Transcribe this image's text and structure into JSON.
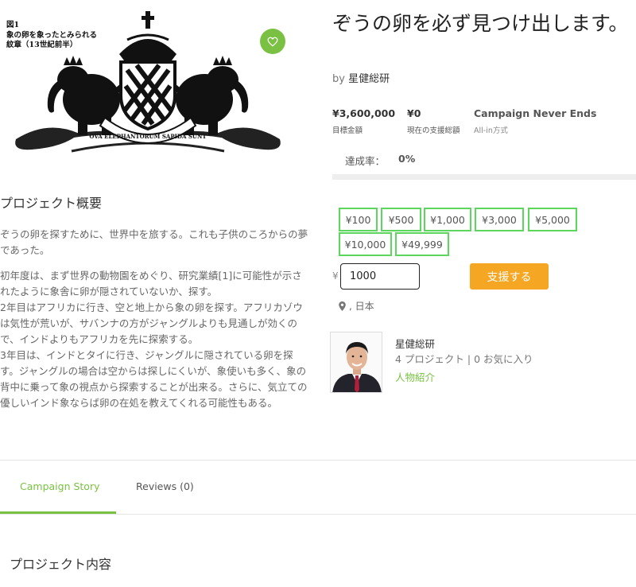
{
  "hero": {
    "caption_lines": [
      "図1",
      "象の卵を象ったとみられる",
      "紋章（13世紀前半）"
    ],
    "banner_text": "OVA ELEPHANTORUM SAPIDA SUNT",
    "favorite_icon": "heart-icon"
  },
  "project": {
    "title": "ぞうの卵を必ず見つけ出します。",
    "by_label": "by",
    "author": "星健総研"
  },
  "stats": {
    "goal_value": "¥3,600,000",
    "goal_label": "目標金額",
    "current_value": "¥0",
    "current_label": "現在の支援総額",
    "ends_value": "Campaign Never Ends",
    "ends_label": "All-in方式",
    "rate_label": "達成率：",
    "rate_value": "0%",
    "progress_fraction": 0
  },
  "amounts": [
    "¥100",
    "¥500",
    "¥1,000",
    "¥3,000",
    "¥5,000",
    "¥10,000",
    "¥49,999"
  ],
  "pledge": {
    "currency": "¥",
    "input_value": "1000",
    "button_label": "支援する"
  },
  "location": {
    "icon": "map-pin-icon",
    "text": ", 日本"
  },
  "creator": {
    "name": "星健総研",
    "stats": "4 プロジェクト | 0 お気に入り",
    "link_label": "人物紹介"
  },
  "summary": {
    "title": "プロジェクト概要",
    "paragraph1": "ぞうの卵を探すために、世界中を旅する。これも子供のころからの夢であった。",
    "line1": "初年度は、まず世界の動物園をめぐり、研究業績[1]に可能性が示されたように象舎に卵が隠されていないか、探す。",
    "line2": "2年目はアフリカに行き、空と地上から象の卵を探す。アフリカゾウは気性が荒いが、サバンナの方がジャングルよりも見通しが効くので、インドよりもアフリカを先に探索する。",
    "line3": "3年目は、インドとタイに行き、ジャングルに隠されている卵を探す。ジャングルの場合は空からは探しにくいが、象使いも多く、象の背中に乗って象の視点から探索することが出来る。さらに、気立ての優しいインド象ならば卵の在処を教えてくれる可能性もある。"
  },
  "tabs": {
    "story": "Campaign Story",
    "reviews": "Reviews (0)"
  },
  "content": {
    "title": "プロジェクト内容"
  },
  "colors": {
    "accent_green": "#7ac143",
    "amount_border": "#5cd65c",
    "support_orange": "#f5a623"
  }
}
